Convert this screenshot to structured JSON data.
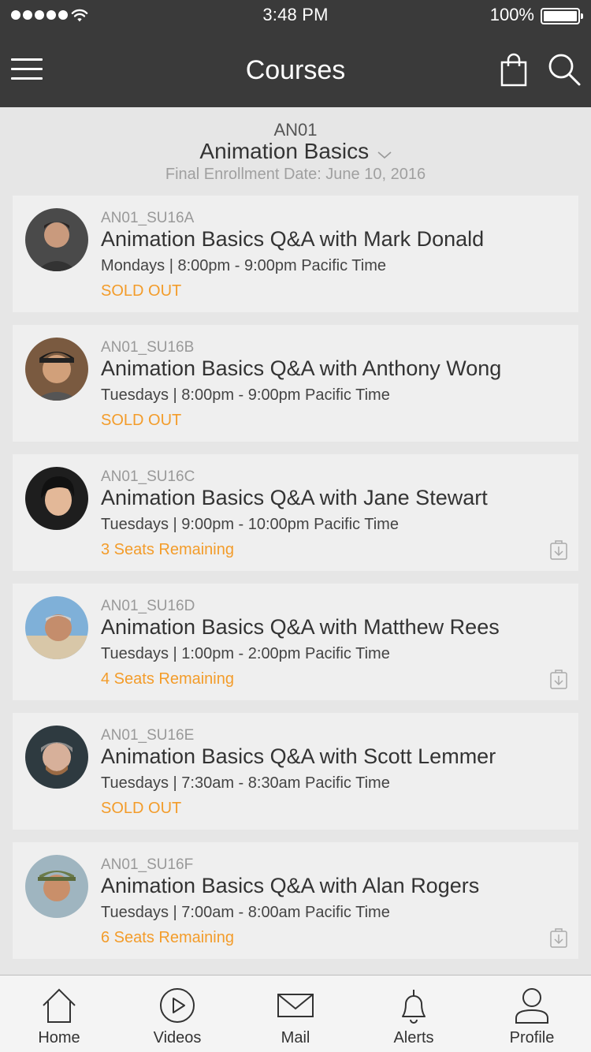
{
  "status_bar": {
    "time": "3:48 PM",
    "battery": "100%",
    "icons": [
      "signal-dots-icon",
      "wifi-icon",
      "battery-icon"
    ]
  },
  "nav": {
    "title": "Courses",
    "icons": [
      "hamburger-menu-icon",
      "shopping-bag-icon",
      "search-icon"
    ]
  },
  "course": {
    "code": "AN01",
    "name": "Animation Basics",
    "enrollment": "Final Enrollment Date: June 10, 2016"
  },
  "sections": [
    {
      "code": "AN01_SU16A",
      "title": "Animation Basics Q&A with Mark Donald",
      "time": "Mondays | 8:00pm - 9:00pm Pacific Time",
      "status": "SOLD OUT",
      "download": false
    },
    {
      "code": "AN01_SU16B",
      "title": "Animation Basics Q&A with Anthony Wong",
      "time": "Tuesdays | 8:00pm - 9:00pm Pacific Time",
      "status": "SOLD OUT",
      "download": false
    },
    {
      "code": "AN01_SU16C",
      "title": "Animation Basics Q&A with Jane Stewart",
      "time": "Tuesdays | 9:00pm - 10:00pm Pacific Time",
      "status": "3 Seats Remaining",
      "download": true
    },
    {
      "code": "AN01_SU16D",
      "title": "Animation Basics Q&A with Matthew Rees",
      "time": "Tuesdays | 1:00pm - 2:00pm Pacific Time",
      "status": "4 Seats Remaining",
      "download": true
    },
    {
      "code": "AN01_SU16E",
      "title": "Animation Basics Q&A with Scott Lemmer",
      "time": "Tuesdays | 7:30am - 8:30am Pacific Time",
      "status": "SOLD OUT",
      "download": false
    },
    {
      "code": "AN01_SU16F",
      "title": "Animation Basics Q&A with Alan Rogers",
      "time": "Tuesdays | 7:00am - 8:00am Pacific Time",
      "status": "6 Seats Remaining",
      "download": true
    }
  ],
  "tabs": [
    {
      "label": "Home",
      "icon": "home-icon"
    },
    {
      "label": "Videos",
      "icon": "play-circle-icon"
    },
    {
      "label": "Mail",
      "icon": "envelope-icon"
    },
    {
      "label": "Alerts",
      "icon": "bell-icon"
    },
    {
      "label": "Profile",
      "icon": "person-icon"
    }
  ],
  "colors": {
    "header_bg": "#3a3a3a",
    "page_bg": "#e6e6e6",
    "card_bg": "#efefef",
    "accent_orange": "#f39c2a"
  }
}
